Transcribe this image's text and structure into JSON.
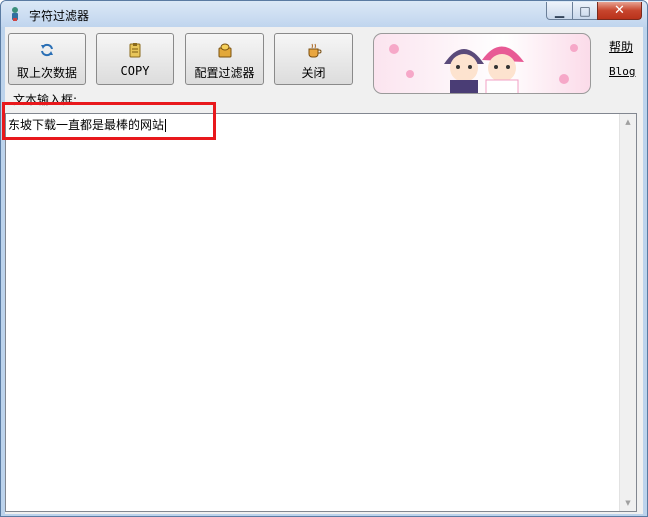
{
  "window": {
    "title": "字符过滤器",
    "app_icon": "filter-tool-icon"
  },
  "title_controls": {
    "minimize_icon": "minimize-icon",
    "maximize_icon": "maximize-icon",
    "close_icon": "close-icon"
  },
  "toolbar": {
    "buttons": [
      {
        "label": "取上次数据",
        "icon": "reload-arrow-icon"
      },
      {
        "label": "COPY",
        "icon": "clipboard-icon"
      },
      {
        "label": "配置过滤器",
        "icon": "coin-box-icon"
      },
      {
        "label": "关闭",
        "icon": "coffee-cup-icon"
      }
    ]
  },
  "banner": {
    "image": "wedding-couple-cartoon"
  },
  "links": {
    "help": "帮助",
    "blog": "Blog"
  },
  "input": {
    "label": "文本输入框:",
    "value": "东坡下载一直都是最棒的网站"
  },
  "colors": {
    "highlight": "#e8181c",
    "title_bar": "#c0d5ee",
    "close_button": "#c7452d"
  }
}
